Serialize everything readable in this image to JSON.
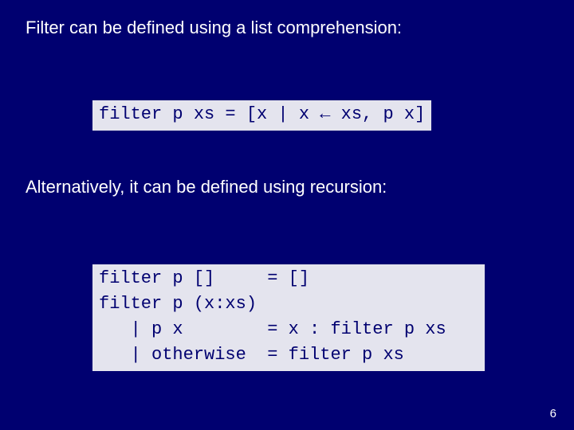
{
  "heading1": "Filter can be defined using a list comprehension:",
  "code1": "filter p xs = [x | x ← xs, p x]",
  "heading2": "Alternatively, it can be defined using recursion:",
  "code2": "filter p []     = []\nfilter p (x:xs)\n   | p x        = x : filter p xs\n   | otherwise  = filter p xs",
  "page_number": "6"
}
